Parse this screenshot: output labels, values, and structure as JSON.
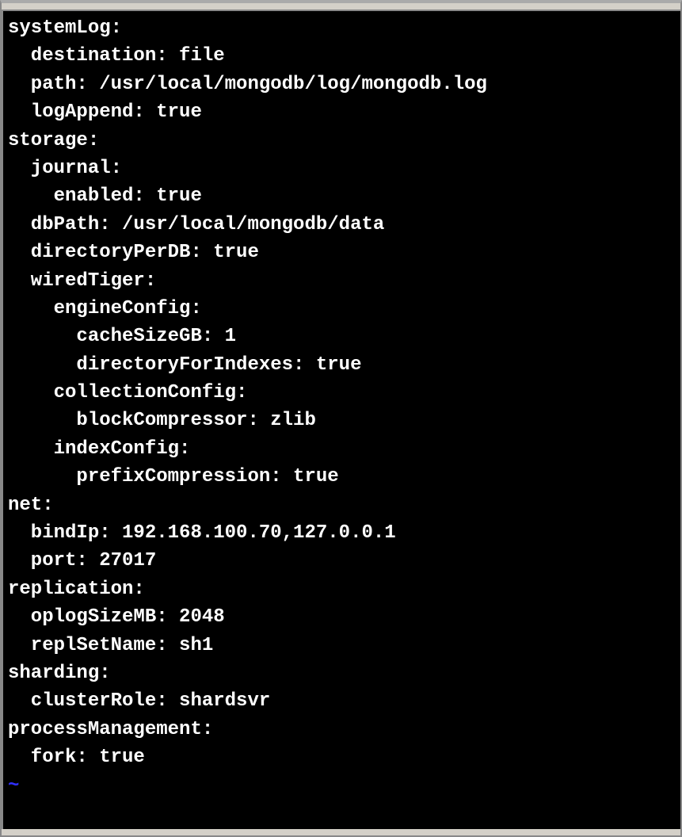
{
  "config": {
    "lines": [
      "systemLog:",
      "  destination: file",
      "  path: /usr/local/mongodb/log/mongodb.log",
      "  logAppend: true",
      "storage:",
      "  journal:",
      "    enabled: true",
      "  dbPath: /usr/local/mongodb/data",
      "  directoryPerDB: true",
      "  wiredTiger:",
      "    engineConfig:",
      "      cacheSizeGB: 1",
      "      directoryForIndexes: true",
      "    collectionConfig:",
      "      blockCompressor: zlib",
      "    indexConfig:",
      "      prefixCompression: true",
      "net:",
      "  bindIp: 192.168.100.70,127.0.0.1",
      "  port: 27017",
      "replication:",
      "  oplogSizeMB: 2048",
      "  replSetName: sh1",
      "sharding:",
      "  clusterRole: shardsvr",
      "processManagement:",
      "  fork: true"
    ],
    "eof_marker": "~"
  }
}
